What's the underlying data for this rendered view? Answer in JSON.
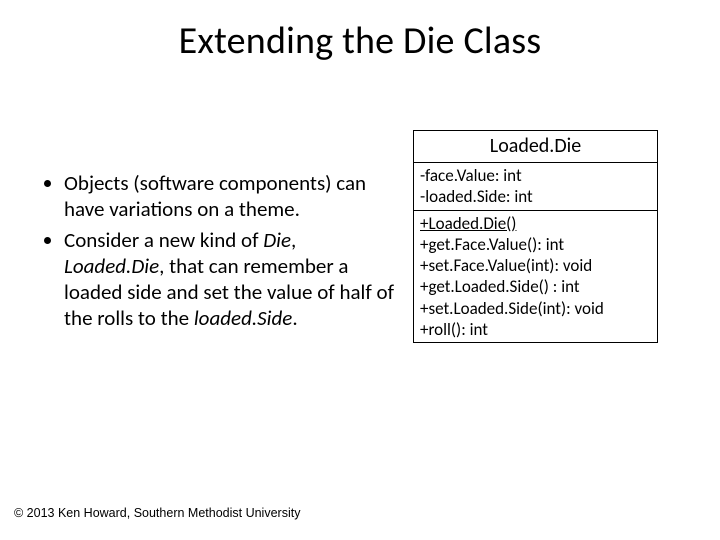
{
  "title": "Extending the Die Class",
  "bullets": {
    "item0": {
      "text": "Objects (software components) can have variations on a theme."
    },
    "item1": {
      "prefix": "Consider a new kind of ",
      "die": "Die",
      "sep1": ", ",
      "loadedDie": "Loaded.Die",
      "mid": ", that can remember a loaded side and set the value of half of the rolls to the ",
      "loadedSide": "loaded.Side",
      "suffix": "."
    }
  },
  "uml": {
    "className": "Loaded.Die",
    "attrs": {
      "a0": "-face.Value: int",
      "a1": "-loaded.Side: int"
    },
    "ops": {
      "o0": "+Loaded.Die()",
      "o1": "+get.Face.Value(): int",
      "o2": "+set.Face.Value(int): void",
      "o3": "+get.Loaded.Side() : int",
      "o4": "+set.Loaded.Side(int): void",
      "o5": "+roll(): int"
    }
  },
  "footer": "© 2013 Ken Howard, Southern Methodist University"
}
